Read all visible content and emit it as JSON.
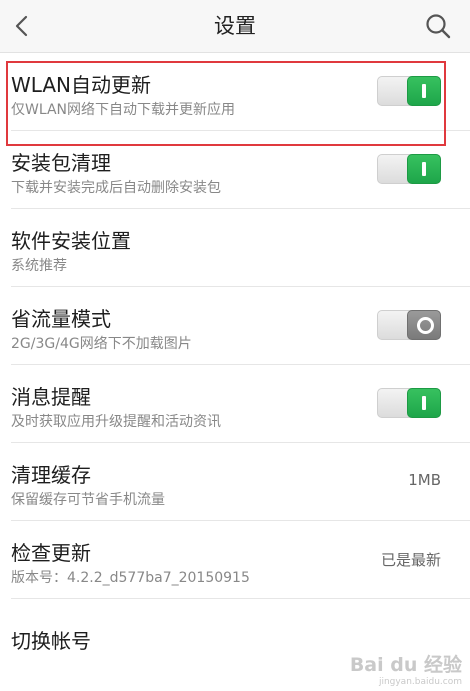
{
  "header": {
    "title": "设置",
    "back_icon": "chevron-left-icon",
    "search_icon": "search-icon"
  },
  "settings": [
    {
      "title": "WLAN自动更新",
      "subtitle": "仅WLAN网络下自动下载并更新应用",
      "control": "toggle",
      "state": "on"
    },
    {
      "title": "安装包清理",
      "subtitle": "下载并安装完成后自动删除安装包",
      "control": "toggle",
      "state": "on"
    },
    {
      "title": "软件安装位置",
      "subtitle": "系统推荐",
      "control": "none"
    },
    {
      "title": "省流量模式",
      "subtitle": "2G/3G/4G网络下不加载图片",
      "control": "toggle",
      "state": "off"
    },
    {
      "title": "消息提醒",
      "subtitle": "及时获取应用升级提醒和活动资讯",
      "control": "toggle",
      "state": "on"
    },
    {
      "title": "清理缓存",
      "subtitle": "保留缓存可节省手机流量",
      "control": "value",
      "value": "1MB"
    },
    {
      "title": "检查更新",
      "subtitle": "版本号：4.2.2_d577ba7_20150915",
      "control": "value",
      "value": "已是最新"
    },
    {
      "title": "切换帐号",
      "subtitle": "",
      "control": "none"
    }
  ],
  "watermark": {
    "brand": "Bai du 经验",
    "url": "jingyan.baidu.com"
  },
  "colors": {
    "toggle_on": "#22a84b",
    "toggle_off": "#7f7f7f",
    "highlight": "#e0393e"
  }
}
